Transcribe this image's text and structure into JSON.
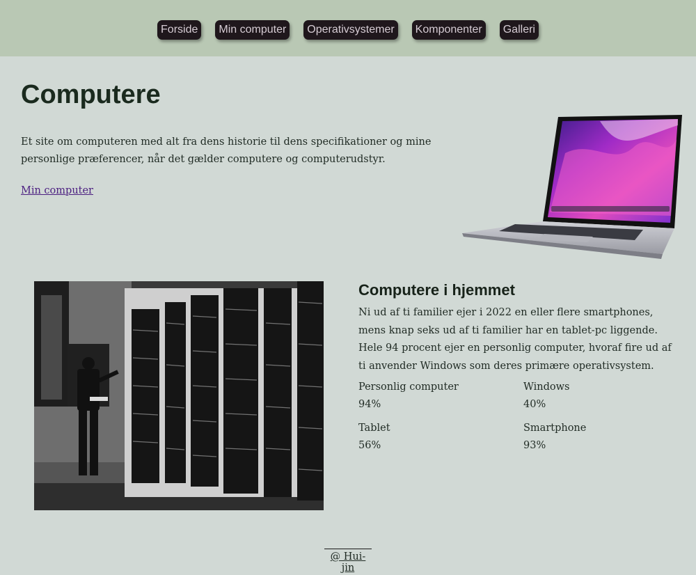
{
  "nav": {
    "items": [
      "Forside",
      "Min computer",
      "Operativsystemer",
      "Komponenter",
      "Galleri"
    ]
  },
  "hero": {
    "title": "Computere",
    "text": "Et site om computeren med alt fra dens historie til dens specifikationer og mine personlige præferencer, når det gælder computere og computerudstyr.",
    "link": "Min computer"
  },
  "section": {
    "title": "Computere i hjemmet",
    "text": "Ni ud af ti familier ejer i 2022 en eller flere smartphones, mens knap seks ud af ti familier har en tablet-pc liggende. Hele 94 procent ejer en personlig computer, hvoraf fire ud af ti anvender Windows som deres primære operativsystem.",
    "stats": [
      {
        "label": "Personlig computer",
        "value": "94%"
      },
      {
        "label": "Windows",
        "value": "40%"
      },
      {
        "label": "Tablet",
        "value": "56%"
      },
      {
        "label": "Smartphone",
        "value": "93%"
      }
    ]
  },
  "footer": {
    "text": "@ Hui-jin"
  },
  "colors": {
    "background": "#d1d9d5",
    "header": "#b9c8b4",
    "nav_button": "#1f171c",
    "link": "#4b1e80"
  }
}
